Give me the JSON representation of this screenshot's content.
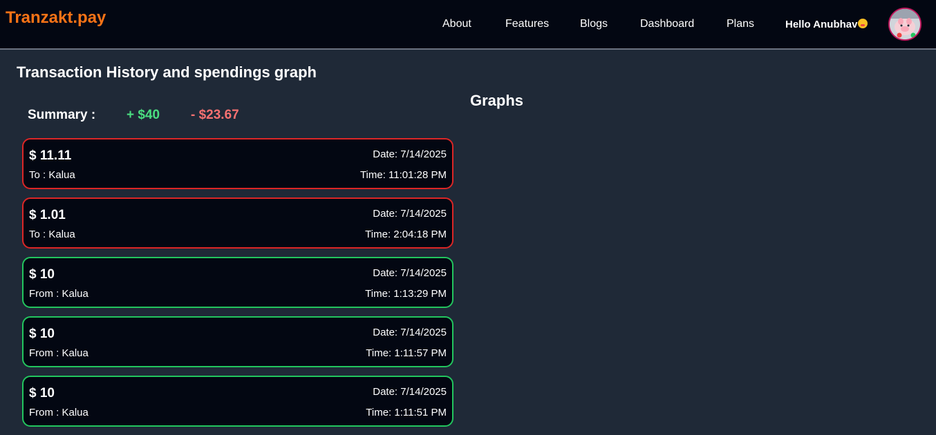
{
  "brand": "Tranzakt.pay",
  "nav": {
    "links": [
      "About",
      "Features",
      "Blogs",
      "Dashboard",
      "Plans"
    ],
    "greeting": "Hello Anubhav"
  },
  "page": {
    "title": "Transaction History and spendings graph",
    "graphs_title": "Graphs"
  },
  "summary": {
    "label": "Summary :",
    "income": "+ $40",
    "expense": "- $23.67"
  },
  "transactions": [
    {
      "type": "debit",
      "amount": "$ 11.11",
      "party": "To : Kalua",
      "date": "Date: 7/14/2025",
      "time": "Time: 11:01:28 PM"
    },
    {
      "type": "debit",
      "amount": "$ 1.01",
      "party": "To : Kalua",
      "date": "Date: 7/14/2025",
      "time": "Time: 2:04:18 PM"
    },
    {
      "type": "credit",
      "amount": "$ 10",
      "party": "From : Kalua",
      "date": "Date: 7/14/2025",
      "time": "Time: 1:13:29 PM"
    },
    {
      "type": "credit",
      "amount": "$ 10",
      "party": "From : Kalua",
      "date": "Date: 7/14/2025",
      "time": "Time: 1:11:57 PM"
    },
    {
      "type": "credit",
      "amount": "$ 10",
      "party": "From : Kalua",
      "date": "Date: 7/14/2025",
      "time": "Time: 1:11:51 PM"
    }
  ],
  "colors": {
    "brand": "#f97316",
    "credit": "#22c55e",
    "debit": "#dc2626",
    "income_text": "#4ade80",
    "expense_text": "#f87171"
  }
}
